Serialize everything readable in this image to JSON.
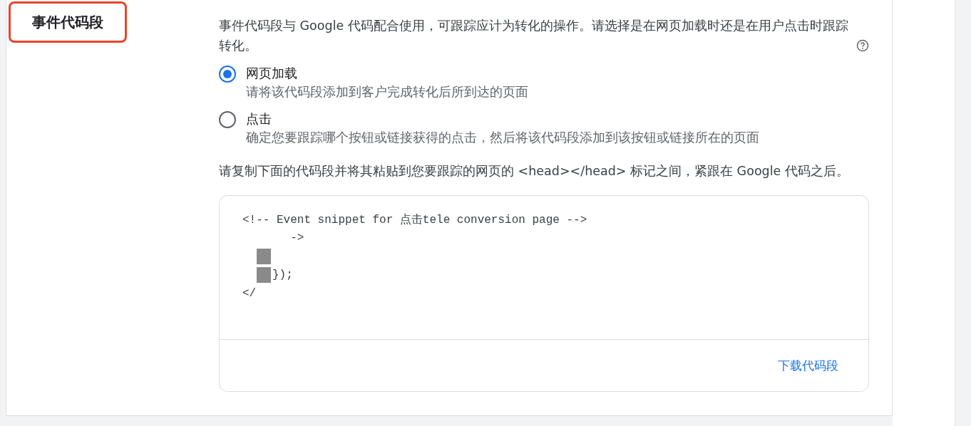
{
  "section": {
    "title": "事件代码段"
  },
  "description": "事件代码段与 Google 代码配合使用，可跟踪应计为转化的操作。请选择是在网页加载时还是在用户点击时跟踪转化。",
  "options": [
    {
      "label": "网页加载",
      "hint": "请将该代码段添加到客户完成转化后所到达的页面",
      "selected": true
    },
    {
      "label": "点击",
      "hint": "确定您要跟踪哪个按钮或链接获得的点击，然后将该代码段添加到该按钮或链接所在的页面",
      "selected": false
    }
  ],
  "instruction": "请复制下面的代码段并将其粘贴到您要跟踪的网页的 <head></head> 标记之间，紧跟在 Google 代码之后。",
  "code_lines": [
    {
      "text": "<!-- Event snippet for 点击tele conversion page -->",
      "redacted": false
    },
    {
      "text": "       ->",
      "redacted": false
    },
    {
      "redacted": true
    },
    {
      "text": "});",
      "redacted": true
    },
    {
      "text": "</",
      "redacted": false
    }
  ],
  "download_link": "下载代码段"
}
